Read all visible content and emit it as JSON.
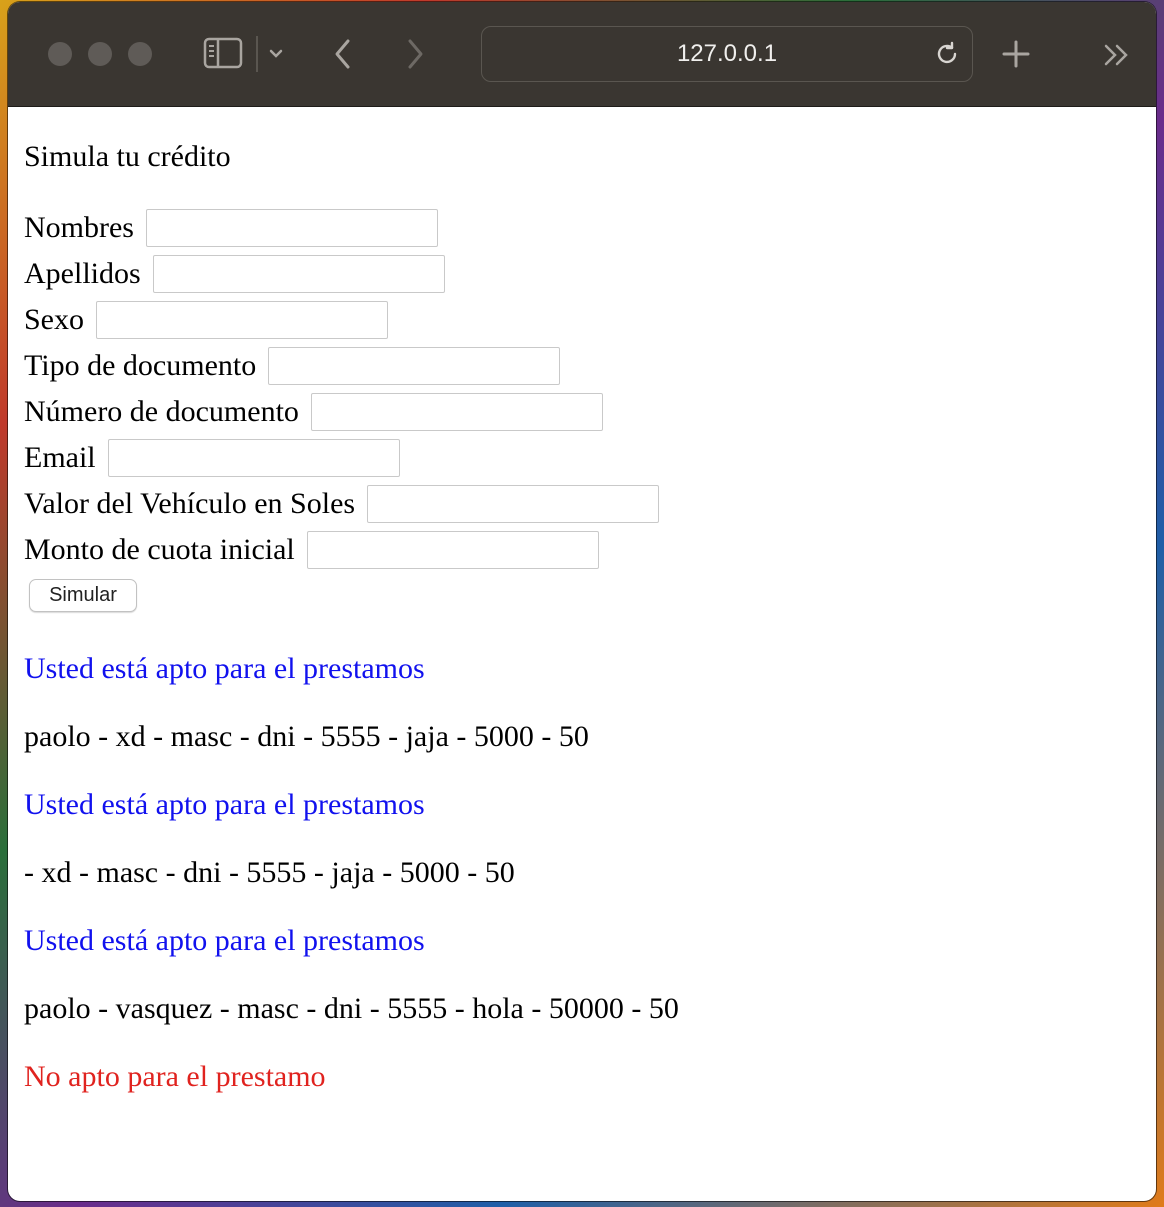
{
  "browser": {
    "url": "127.0.0.1"
  },
  "page": {
    "title": "Simula tu crédito",
    "fields": [
      {
        "label": "Nombres",
        "value": ""
      },
      {
        "label": "Apellidos",
        "value": ""
      },
      {
        "label": "Sexo",
        "value": ""
      },
      {
        "label": "Tipo de documento",
        "value": ""
      },
      {
        "label": "Número de documento",
        "value": ""
      },
      {
        "label": "Email",
        "value": ""
      },
      {
        "label": "Valor del Vehículo en Soles",
        "value": ""
      },
      {
        "label": "Monto de cuota inicial",
        "value": ""
      }
    ],
    "button_label": "Simular",
    "results": [
      {
        "text": "Usted está apto para el prestamos",
        "status": "apto"
      },
      {
        "text": "paolo - xd - masc - dni - 5555 - jaja - 5000 - 50",
        "status": "detalle"
      },
      {
        "text": "Usted está apto para el prestamos",
        "status": "apto"
      },
      {
        "text": "- xd - masc - dni - 5555 - jaja - 5000 - 50",
        "status": "detalle"
      },
      {
        "text": "Usted está apto para el prestamos",
        "status": "apto"
      },
      {
        "text": "paolo - vasquez - masc - dni - 5555 - hola - 50000 - 50",
        "status": "detalle"
      },
      {
        "text": "No apto para el prestamo",
        "status": "no-apto"
      }
    ]
  },
  "colors": {
    "apto": "#1111ee",
    "no_apto": "#e0231f"
  }
}
